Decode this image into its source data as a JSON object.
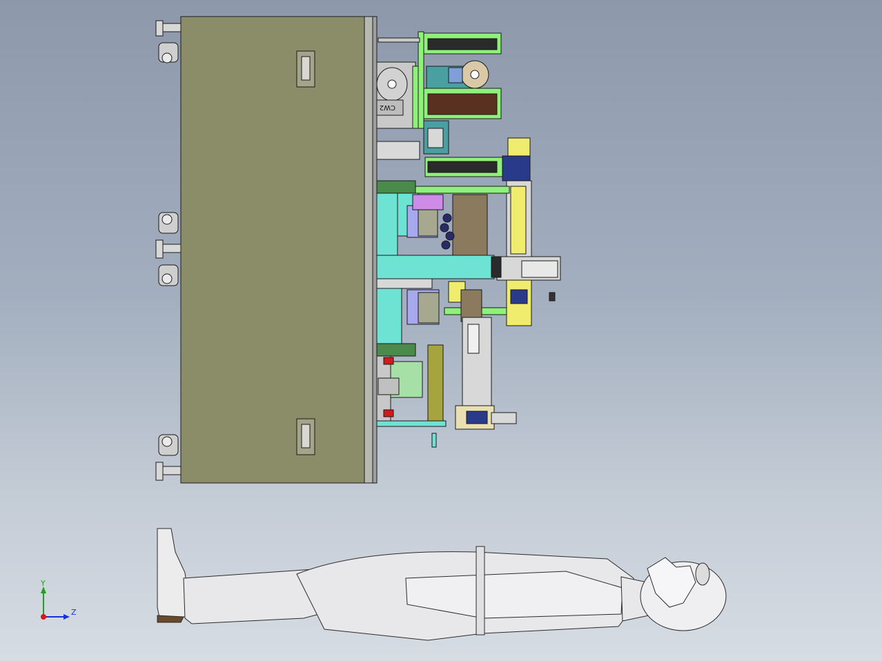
{
  "viewport": {
    "background_top": "#8d99ab",
    "background_bottom": "#d6dce3",
    "machine_cabinet_color": "#8b8c68",
    "machine_parts_colors": [
      "#6ee3d4",
      "#8ff07a",
      "#f0ec6e",
      "#a6a8f0",
      "#cf8be8",
      "#8b7a5e",
      "#4aa0a0"
    ],
    "human_figure_color": "#e8e8ea"
  },
  "cabinet": {
    "label_on_component": "CW2"
  },
  "triad": {
    "y_label": "Y",
    "z_label": "Z",
    "y_color": "#1aa31a",
    "z_color": "#1a2fd6",
    "origin_color": "#d21a1a"
  }
}
